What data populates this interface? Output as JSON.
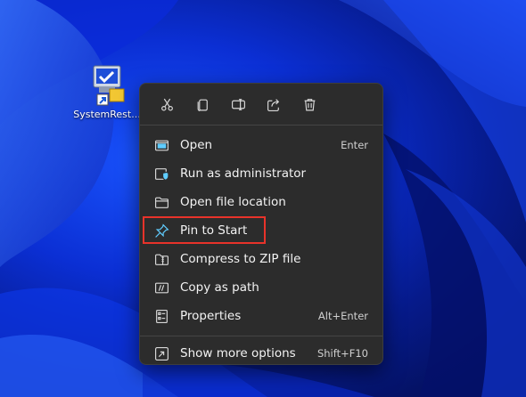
{
  "desktop": {
    "icon_label": "SystemRest...",
    "icon_name": "system-restore-shortcut-icon"
  },
  "menu": {
    "toolbar": [
      {
        "name": "cut-icon",
        "action": "Cut"
      },
      {
        "name": "copy-icon",
        "action": "Copy"
      },
      {
        "name": "rename-icon",
        "action": "Rename"
      },
      {
        "name": "share-icon",
        "action": "Share"
      },
      {
        "name": "delete-icon",
        "action": "Delete"
      }
    ],
    "items": [
      {
        "label": "Open",
        "shortcut": "Enter",
        "icon": "open-icon"
      },
      {
        "label": "Run as administrator",
        "shortcut": "",
        "icon": "run-as-admin-icon"
      },
      {
        "label": "Open file location",
        "shortcut": "",
        "icon": "folder-icon"
      },
      {
        "label": "Pin to Start",
        "shortcut": "",
        "icon": "pin-icon",
        "highlighted": true
      },
      {
        "label": "Compress to ZIP file",
        "shortcut": "",
        "icon": "zip-icon"
      },
      {
        "label": "Copy as path",
        "shortcut": "",
        "icon": "copy-path-icon"
      },
      {
        "label": "Properties",
        "shortcut": "Alt+Enter",
        "icon": "properties-icon"
      }
    ],
    "more": {
      "label": "Show more options",
      "shortcut": "Shift+F10",
      "icon": "more-options-icon"
    }
  },
  "colors": {
    "menu_bg": "#2c2c2c",
    "highlight_border": "#e8332a",
    "accent_blue": "#60cdff"
  }
}
